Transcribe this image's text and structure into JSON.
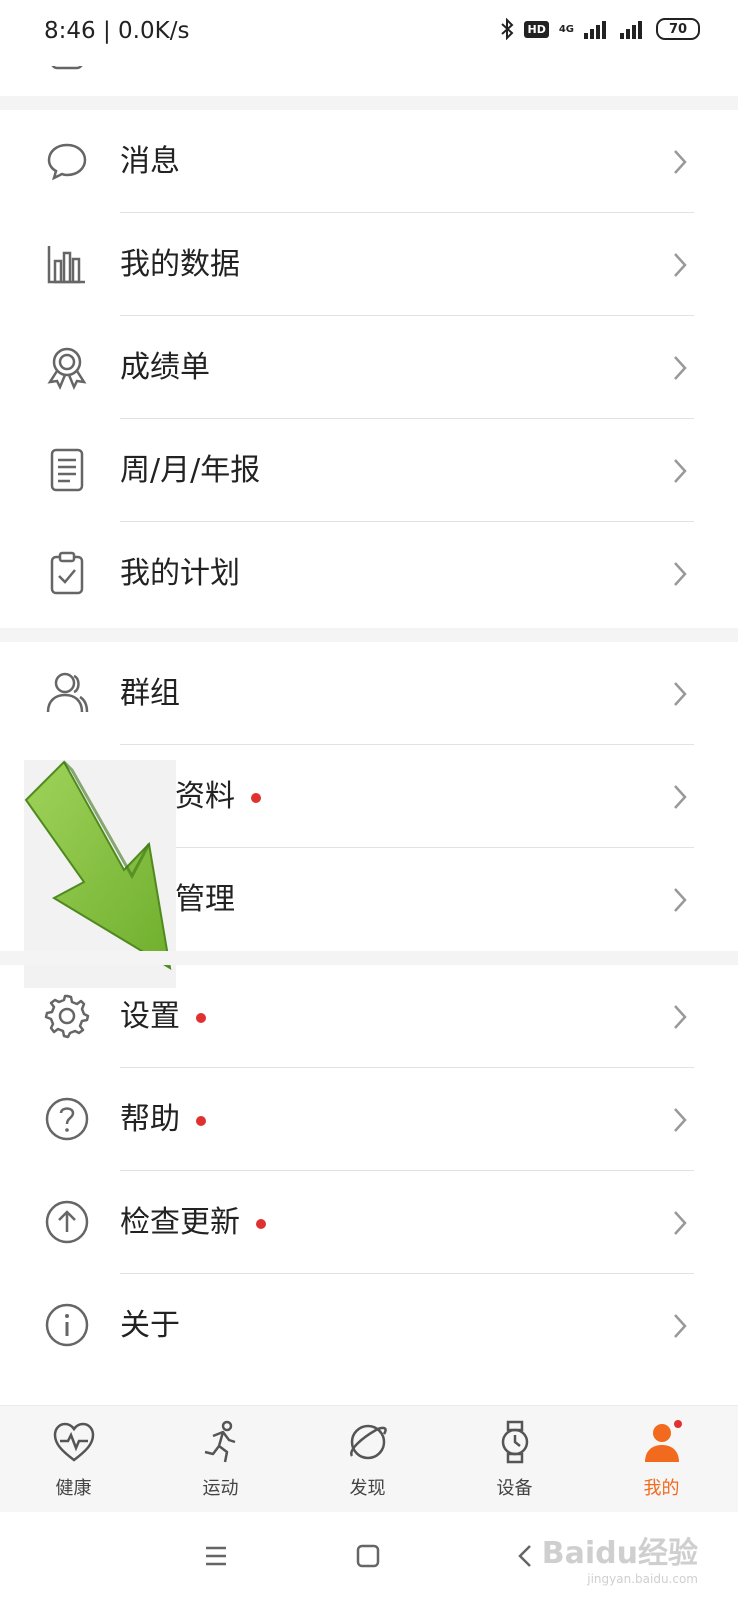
{
  "status_bar": {
    "time": "8:46",
    "speed": "0.0K/s",
    "hd": "HD",
    "network": "4G",
    "battery": "70"
  },
  "menu": {
    "group1": [
      {
        "key": "messages",
        "label": "消息",
        "icon": "message-bubble-icon",
        "dot": false
      },
      {
        "key": "my-data",
        "label": "我的数据",
        "icon": "bar-chart-icon",
        "dot": false
      },
      {
        "key": "report-card",
        "label": "成绩单",
        "icon": "award-medal-icon",
        "dot": false
      },
      {
        "key": "periodic-report",
        "label": "周/月/年报",
        "icon": "report-notebook-icon",
        "dot": false
      },
      {
        "key": "my-plan",
        "label": "我的计划",
        "icon": "clipboard-check-icon",
        "dot": false
      }
    ],
    "group2": [
      {
        "key": "groups",
        "label": "群组",
        "icon": "people-icon",
        "dot": false
      },
      {
        "key": "profile",
        "label": "资料",
        "icon": "profile-icon",
        "dot": true
      },
      {
        "key": "management",
        "label": "管理",
        "icon": "manage-icon",
        "dot": false
      }
    ],
    "group3": [
      {
        "key": "settings",
        "label": "设置",
        "icon": "gear-icon",
        "dot": true
      },
      {
        "key": "help",
        "label": "帮助",
        "icon": "question-icon",
        "dot": true
      },
      {
        "key": "check-update",
        "label": "检查更新",
        "icon": "upload-arrow-icon",
        "dot": true
      },
      {
        "key": "about",
        "label": "关于",
        "icon": "info-icon",
        "dot": false
      }
    ]
  },
  "tabs": [
    {
      "key": "health",
      "label": "健康",
      "icon": "heart-pulse-icon",
      "active": false
    },
    {
      "key": "exercise",
      "label": "运动",
      "icon": "runner-icon",
      "active": false
    },
    {
      "key": "discover",
      "label": "发现",
      "icon": "planet-icon",
      "active": false
    },
    {
      "key": "device",
      "label": "设备",
      "icon": "watch-icon",
      "active": false
    },
    {
      "key": "me",
      "label": "我的",
      "icon": "person-icon",
      "active": true
    }
  ],
  "watermark": {
    "brand": "Baidu经验",
    "url": "jingyan.baidu.com"
  },
  "colors": {
    "accent": "#f26a1e",
    "dot": "#e03131",
    "arrow": "#8cc63f"
  }
}
